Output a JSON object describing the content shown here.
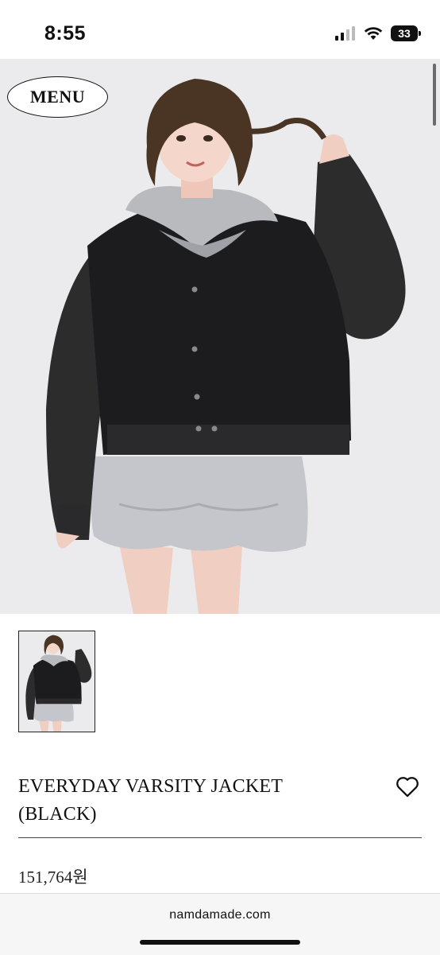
{
  "status_bar": {
    "time": "8:55",
    "battery": "33"
  },
  "header": {
    "menu_label": "MENU"
  },
  "product": {
    "title_line1": "EVERYDAY VARSITY JACKET",
    "title_line2": "(BLACK)",
    "price": "151,764원"
  },
  "browser": {
    "url": "namdamade.com"
  }
}
